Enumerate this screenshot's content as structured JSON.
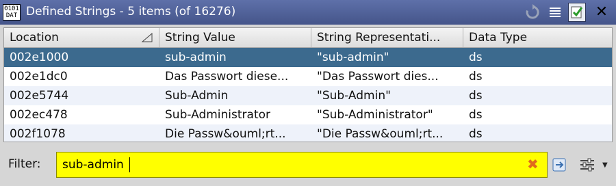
{
  "window": {
    "title": "Defined Strings - 5 items (of 16276)",
    "app_icon_text": "0101\nDAT"
  },
  "table": {
    "columns": [
      "Location",
      "String Value",
      "String Representati...",
      "Data Type"
    ],
    "rows": [
      {
        "location": "002e1000",
        "value": "sub-admin",
        "representation": "\"sub-admin\"",
        "type": "ds"
      },
      {
        "location": "002e1dc0",
        "value": "Das Passwort diese...",
        "representation": "\"Das Passwort dies...",
        "type": "ds"
      },
      {
        "location": "002e5744",
        "value": "Sub-Admin",
        "representation": "\"Sub-Admin\"",
        "type": "ds"
      },
      {
        "location": "002ec478",
        "value": "Sub-Administrator",
        "representation": "\"Sub-Administrator\"",
        "type": "ds"
      },
      {
        "location": "002f1078",
        "value": "Die Passw&ouml;rt...",
        "representation": "\"Die Passw&ouml;rt...",
        "type": "ds"
      }
    ]
  },
  "filter": {
    "label": "Filter:",
    "value": "sub-admin"
  },
  "colors": {
    "title_bar": "#4f5f96",
    "selected_row": "#3c6a8e",
    "filter_background": "#ffff00"
  }
}
